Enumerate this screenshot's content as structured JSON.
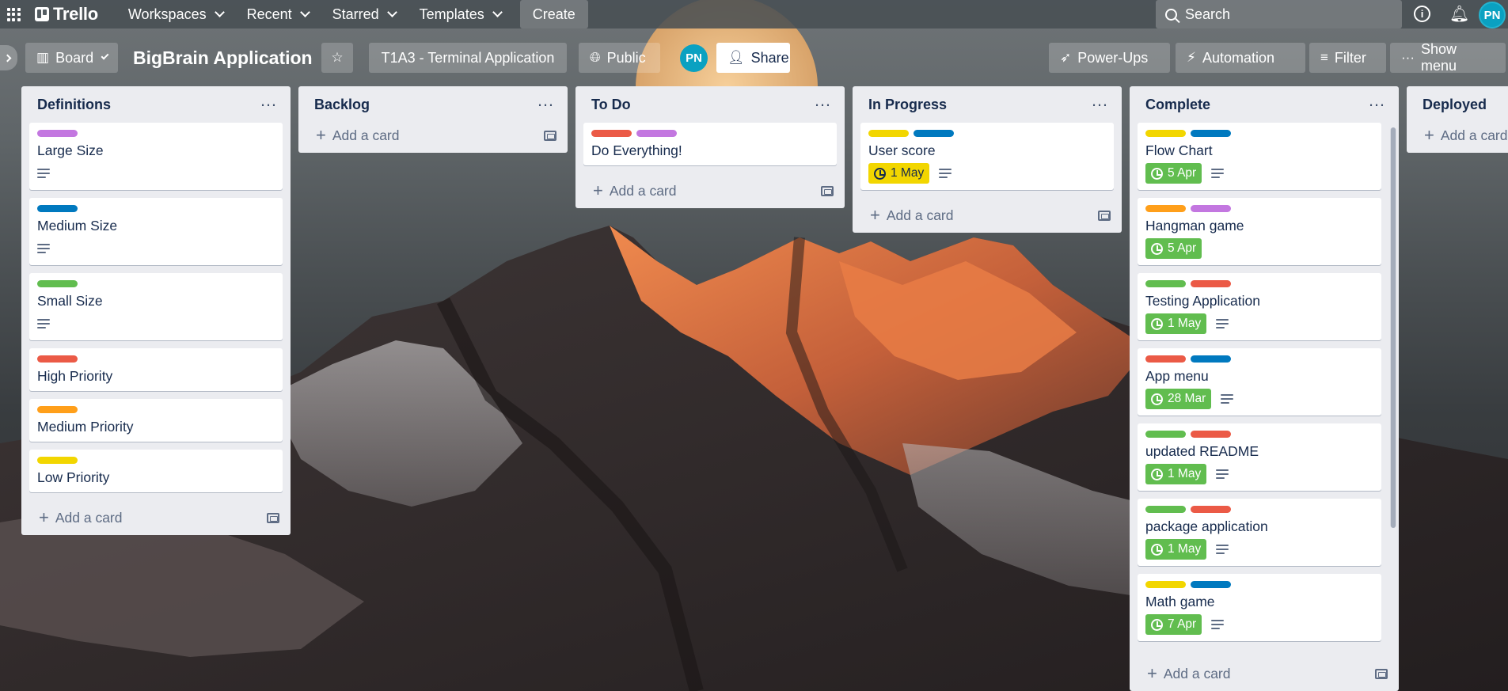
{
  "nav": {
    "logo": "Trello",
    "workspaces": "Workspaces",
    "recent": "Recent",
    "starred": "Starred",
    "templates": "Templates",
    "create": "Create",
    "search_placeholder": "Search",
    "avatar_initials": "PN"
  },
  "board": {
    "view": "Board",
    "title": "BigBrain Application",
    "workspace": "T1A3 - Terminal Application",
    "visibility": "Public",
    "member_initials": "PN",
    "share": "Share",
    "powerups": "Power-Ups",
    "automation": "Automation",
    "filter": "Filter",
    "show_menu": "Show menu"
  },
  "label_colors": {
    "purple": "#c377e0",
    "blue": "#0079bf",
    "green": "#61bd4f",
    "red": "#eb5a46",
    "orange": "#ff9f1a",
    "yellow": "#f2d600"
  },
  "add_card": "Add a card",
  "lists": [
    {
      "title": "Definitions",
      "cards": [
        {
          "title": "Large Size",
          "labels": [
            "purple"
          ],
          "due": null,
          "desc": true
        },
        {
          "title": "Medium Size",
          "labels": [
            "blue"
          ],
          "due": null,
          "desc": true
        },
        {
          "title": "Small Size",
          "labels": [
            "green"
          ],
          "due": null,
          "desc": true
        },
        {
          "title": "High Priority",
          "labels": [
            "red"
          ],
          "due": null,
          "desc": false
        },
        {
          "title": "Medium Priority",
          "labels": [
            "orange"
          ],
          "due": null,
          "desc": false
        },
        {
          "title": "Low Priority",
          "labels": [
            "yellow"
          ],
          "due": null,
          "desc": false
        }
      ]
    },
    {
      "title": "Backlog",
      "cards": []
    },
    {
      "title": "To Do",
      "cards": [
        {
          "title": "Do Everything!",
          "labels": [
            "red",
            "purple"
          ],
          "due": null,
          "desc": false
        }
      ]
    },
    {
      "title": "In Progress",
      "cards": [
        {
          "title": "User score",
          "labels": [
            "yellow",
            "blue"
          ],
          "due": "1 May",
          "due_status": "yellow",
          "desc": true
        }
      ]
    },
    {
      "title": "Complete",
      "cards": [
        {
          "title": "Flow Chart",
          "labels": [
            "yellow",
            "blue"
          ],
          "due": "5 Apr",
          "due_status": "green",
          "desc": true
        },
        {
          "title": "Hangman game",
          "labels": [
            "orange",
            "purple"
          ],
          "due": "5 Apr",
          "due_status": "green",
          "desc": false
        },
        {
          "title": "Testing Application",
          "labels": [
            "green",
            "red"
          ],
          "due": "1 May",
          "due_status": "green",
          "desc": true
        },
        {
          "title": "App menu",
          "labels": [
            "red",
            "blue"
          ],
          "due": "28 Mar",
          "due_status": "green",
          "desc": true
        },
        {
          "title": "updated README",
          "labels": [
            "green",
            "red"
          ],
          "due": "1 May",
          "due_status": "green",
          "desc": true
        },
        {
          "title": "package application",
          "labels": [
            "green",
            "red"
          ],
          "due": "1 May",
          "due_status": "green",
          "desc": true
        },
        {
          "title": "Math game",
          "labels": [
            "yellow",
            "blue"
          ],
          "due": "7 Apr",
          "due_status": "green",
          "desc": true
        }
      ]
    },
    {
      "title": "Deployed",
      "cards": []
    }
  ]
}
